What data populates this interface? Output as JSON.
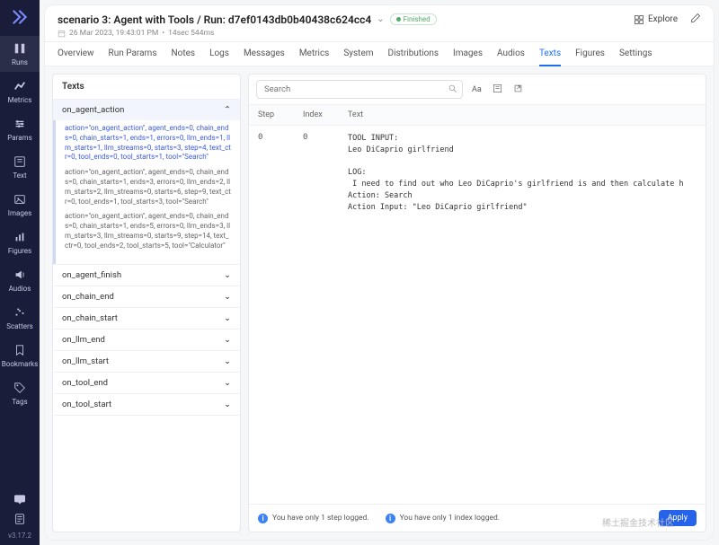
{
  "appbar": {
    "items": [
      {
        "label": "Runs",
        "icon": "runs"
      },
      {
        "label": "Metrics",
        "icon": "metrics"
      },
      {
        "label": "Params",
        "icon": "params"
      },
      {
        "label": "Text",
        "icon": "text"
      },
      {
        "label": "Images",
        "icon": "images"
      },
      {
        "label": "Figures",
        "icon": "figures"
      },
      {
        "label": "Audios",
        "icon": "audios"
      },
      {
        "label": "Scatters",
        "icon": "scatters"
      },
      {
        "label": "Bookmarks",
        "icon": "bookmarks"
      },
      {
        "label": "Tags",
        "icon": "tags"
      }
    ],
    "version": "v3.17.2"
  },
  "header": {
    "title": "scenario 3: Agent with Tools / Run: d7ef0143db0b40438c624cc4",
    "status": "Finished",
    "date": "26 Mar 2023, 19:43:01 PM",
    "duration": "14sec 544ms",
    "explore": "Explore"
  },
  "tabs": [
    "Overview",
    "Run Params",
    "Notes",
    "Logs",
    "Messages",
    "Metrics",
    "System",
    "Distributions",
    "Images",
    "Audios",
    "Texts",
    "Figures",
    "Settings"
  ],
  "active_tab": "Texts",
  "side": {
    "title": "Texts",
    "expanded": "on_agent_action",
    "cards": [
      "action=\"on_agent_action\", agent_ends=0, chain_ends=0, chain_starts=1, ends=1, errors=0, llm_ends=1, llm_starts=1, llm_streams=0, starts=3, step=4, text_ctr=0, tool_ends=0, tool_starts=1, tool=\"Search\"",
      "action=\"on_agent_action\", agent_ends=0, chain_ends=0, chain_starts=1, ends=3, errors=0, llm_ends=2, llm_starts=2, llm_streams=0, starts=6, step=9, text_ctr=0, tool_ends=1, tool_starts=3, tool=\"Search\"",
      "action=\"on_agent_action\", agent_ends=0, chain_ends=0, chain_starts=1, ends=5, errors=0, llm_ends=3, llm_starts=3, llm_streams=0, starts=9, step=14, text_ctr=0, tool_ends=2, tool_starts=5, tool=\"Calculator\""
    ],
    "others": [
      "on_agent_finish",
      "on_chain_end",
      "on_chain_start",
      "on_llm_end",
      "on_llm_start",
      "on_tool_end",
      "on_tool_start"
    ]
  },
  "panel": {
    "search_placeholder": "Search",
    "columns": {
      "step": "Step",
      "index": "Index",
      "text": "Text"
    },
    "row": {
      "step": "0",
      "index": "0",
      "text": "TOOL INPUT:\nLeo DiCaprio girlfriend\n\nLOG:\n I need to find out who Leo DiCaprio's girlfriend is and then calculate h\nAction: Search\nAction Input: \"Leo DiCaprio girlfriend\""
    },
    "footer": {
      "msg1": "You have only 1 step logged.",
      "msg2": "You have only 1 index logged.",
      "apply": "Apply"
    }
  },
  "watermark": "稀土掘金技术社区"
}
